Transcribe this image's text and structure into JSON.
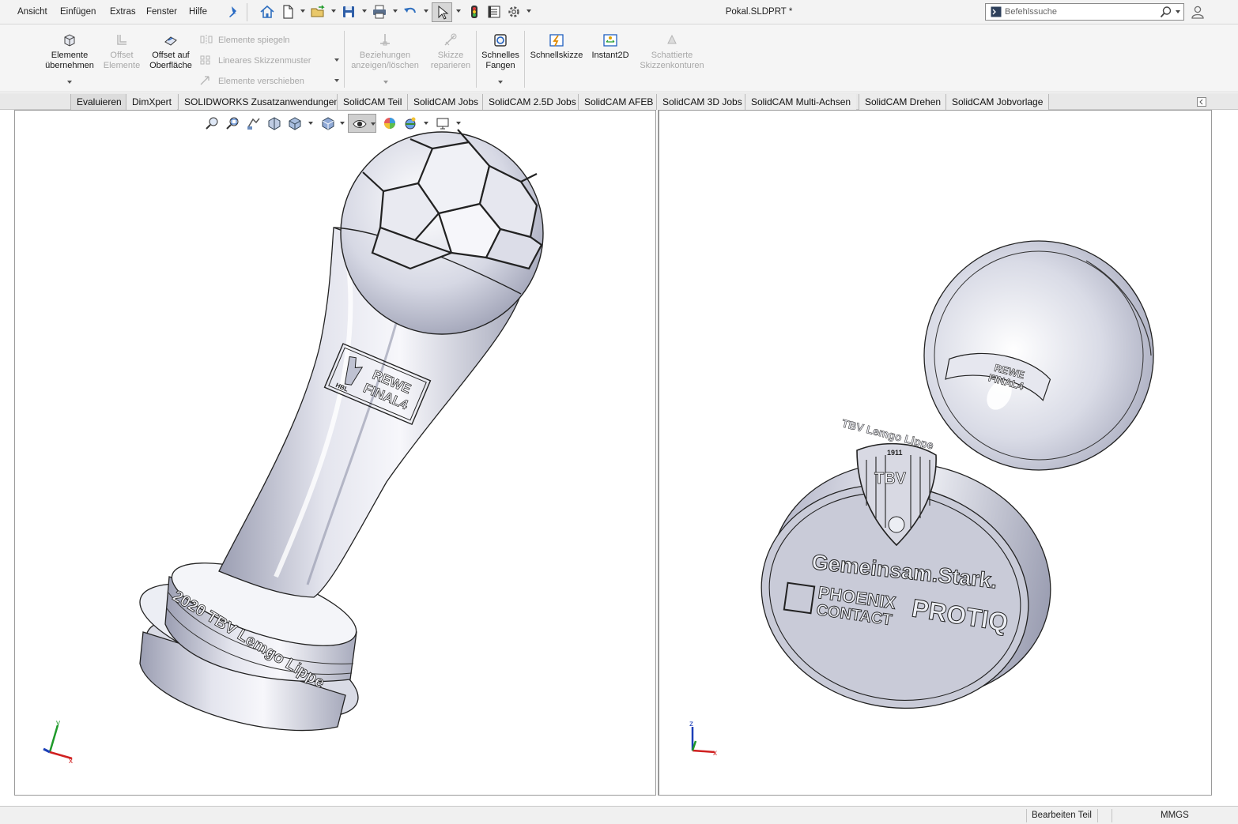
{
  "menu": {
    "items": [
      "Ansicht",
      "Einfügen",
      "Extras",
      "Fenster",
      "Hilfe"
    ]
  },
  "document": {
    "title": "Pokal.SLDPRT *"
  },
  "search": {
    "placeholder": "Befehlssuche"
  },
  "command_manager": {
    "convert_entities": "Elemente\nübernehmen",
    "offset_entities": "Offset\nElemente",
    "offset_on_surface": "Offset auf\nOberfläche",
    "mirror_entities": "Elemente spiegeln",
    "linear_pattern": "Lineares Skizzenmuster",
    "move_entities": "Elemente verschieben",
    "display_relations": "Beziehungen\nanzeigen/löschen",
    "repair_sketch": "Skizze\nreparieren",
    "quick_snaps": "Schnelles\nFangen",
    "rapid_sketch": "Schnellskizze",
    "instant2d": "Instant2D",
    "shaded_contours": "Schattierte\nSkizzenkonturen"
  },
  "tabs": [
    "Evaluieren",
    "DimXpert",
    "SOLIDWORKS Zusatzanwendungen",
    "SolidCAM Teil",
    "SolidCAM Jobs",
    "SolidCAM 2.5D Jobs",
    "SolidCAM AFEB",
    "SolidCAM 3D Jobs",
    "SolidCAM Multi-Achsen",
    "SolidCAM Drehen",
    "SolidCAM Jobvorlage"
  ],
  "model_left": {
    "base_text": "2020 TBV Lemgo Lippe",
    "logo_line1": "REWE",
    "logo_line2": "FINAL4",
    "logo_small": "HBL"
  },
  "model_right": {
    "crest_year": "1911",
    "crest_text": "TBV",
    "slogan": "Gemeinsam.Stark.",
    "sponsor1": "PHOENIX",
    "sponsor2": "CONTACT",
    "sponsor3": "PROTIQ",
    "rim_text": "TBV Lemgo Lippe",
    "logo_line1": "REWE",
    "logo_line2": "FINAL4"
  },
  "triad": {
    "x": "x",
    "y": "y",
    "z": "z"
  },
  "status": {
    "edit_mode": "Bearbeiten Teil",
    "units": "MMGS"
  },
  "colors": {
    "accent": "#0a64b4",
    "triad_x": "#d02020",
    "triad_y": "#1f9a2a",
    "triad_z": "#1c3fb8",
    "model_metal": "#c9cbd8"
  }
}
